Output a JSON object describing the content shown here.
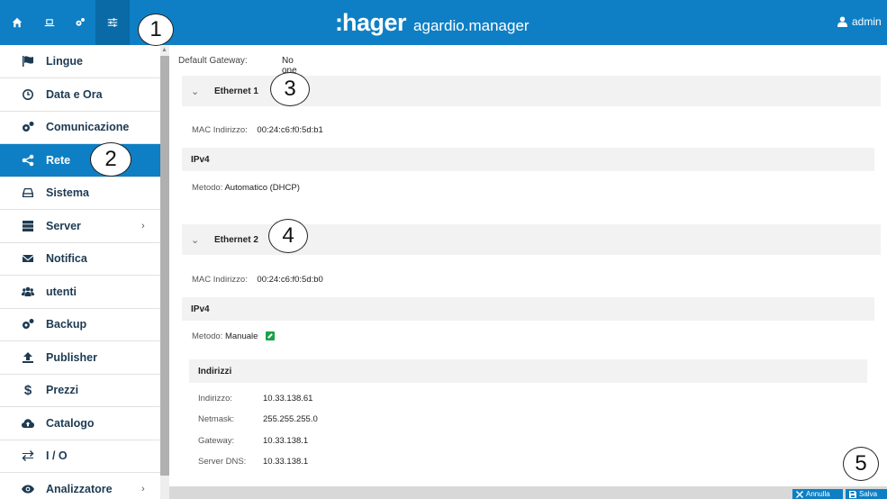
{
  "topbar": {
    "nav_icons": [
      "home-icon",
      "laptop-icon",
      "gears-icon",
      "sliders-icon"
    ],
    "brand_colon": ":",
    "brand_name": "hager",
    "product": "agardio.manager",
    "user": "admin",
    "color": "#0e7fc4"
  },
  "sidebar": {
    "items": [
      {
        "label": "Lingue",
        "icon": "flag-icon"
      },
      {
        "label": "Data e Ora",
        "icon": "clock-icon"
      },
      {
        "label": "Comunicazione",
        "icon": "gears-icon"
      },
      {
        "label": "Rete",
        "icon": "share-icon",
        "active": true
      },
      {
        "label": "Sistema",
        "icon": "drive-icon"
      },
      {
        "label": "Server",
        "icon": "server-icon",
        "submenu": true
      },
      {
        "label": "Notifica",
        "icon": "envelope-icon"
      },
      {
        "label": "utenti",
        "icon": "users-icon"
      },
      {
        "label": "Backup",
        "icon": "gears-icon"
      },
      {
        "label": "Publisher",
        "icon": "upload-icon"
      },
      {
        "label": "Prezzi",
        "icon": "dollar-icon"
      },
      {
        "label": "Catalogo",
        "icon": "cloud-upload-icon"
      },
      {
        "label": "I / O",
        "icon": "exchange-icon"
      },
      {
        "label": "Analizzatore",
        "icon": "eye-icon",
        "submenu": true
      }
    ]
  },
  "main": {
    "default_gateway_label": "Default Gateway:",
    "default_gateway_value": "No one",
    "eth1": {
      "title": "Ethernet 1",
      "mac_label": "MAC Indirizzo:",
      "mac_value": "00:24:c6:f0:5d:b1",
      "ipv4": "IPv4",
      "method_label": "Metodo:",
      "method_value": "Automatico (DHCP)"
    },
    "eth2": {
      "title": "Ethernet 2",
      "mac_label": "MAC Indirizzo:",
      "mac_value": "00:24:c6:f0:5d:b0",
      "ipv4": "IPv4",
      "method_label": "Metodo:",
      "method_value": "Manuale",
      "addresses_title": "Indirizzi",
      "addr_label": "Indirizzo:",
      "addr_value": "10.33.138.61",
      "netmask_label": "Netmask:",
      "netmask_value": "255.255.255.0",
      "gateway_label": "Gateway:",
      "gateway_value": "10.33.138.1",
      "dns_label": "Server DNS:",
      "dns_value": "10.33.138.1"
    }
  },
  "footer": {
    "cancel": "Annulla",
    "save": "Salva"
  },
  "callouts": [
    "1",
    "2",
    "3",
    "4",
    "5"
  ]
}
